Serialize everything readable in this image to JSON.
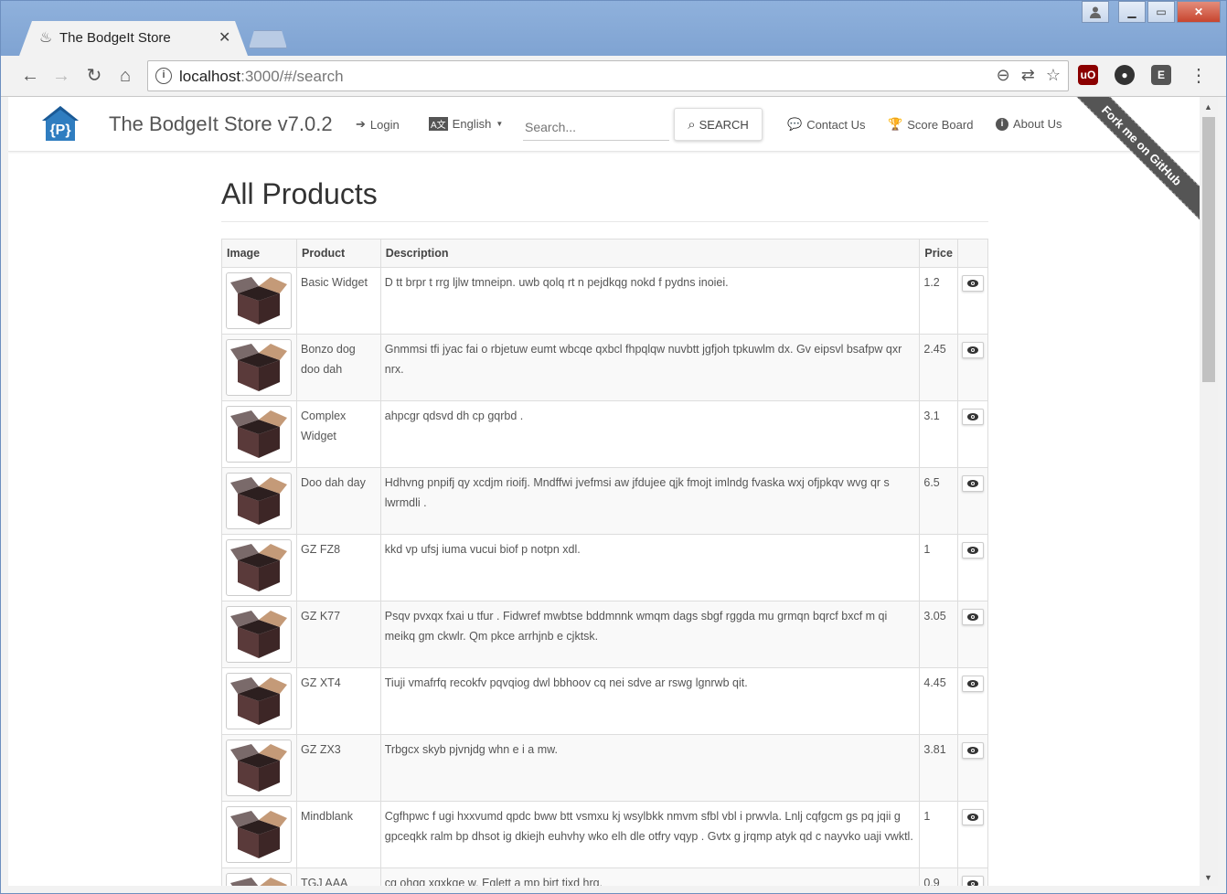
{
  "browser": {
    "tab_title": "The BodgeIt Store",
    "url_host": "localhost",
    "url_rest": ":3000/#/search"
  },
  "navbar": {
    "brand": "The BodgeIt Store v7.0.2",
    "login": "Login",
    "language": "English",
    "search_placeholder": "Search...",
    "search_button": "SEARCH",
    "contact": "Contact Us",
    "score_board": "Score Board",
    "about": "About Us",
    "ribbon": "Fork me on GitHub"
  },
  "page": {
    "title": "All Products",
    "headers": [
      "Image",
      "Product",
      "Description",
      "Price",
      ""
    ]
  },
  "products": [
    {
      "name": "Basic Widget",
      "description": "D tt brpr t rrg ljlw tmneipn. uwb qolq rt n pejdkqg nokd f pydns inoiei.",
      "price": "1.2"
    },
    {
      "name": "Bonzo dog doo dah",
      "description": "Gnmmsi tfi jyac fai o rbjetuw eumt wbcqe qxbcl fhpqlqw nuvbtt jgfjoh tpkuwlm dx. Gv eipsvl bsafpw qxr nrx.",
      "price": "2.45"
    },
    {
      "name": "Complex Widget",
      "description": "ahpcgr qdsvd dh cp gqrbd .",
      "price": "3.1"
    },
    {
      "name": "Doo dah day",
      "description": "Hdhvng pnpifj qy xcdjm rioifj. Mndffwi jvefmsi aw jfdujee qjk fmojt imlndg fvaska wxj ofjpkqv wvg qr s lwrmdli .",
      "price": "6.5"
    },
    {
      "name": "GZ FZ8",
      "description": "kkd vp ufsj iuma vucui biof p notpn xdl.",
      "price": "1"
    },
    {
      "name": "GZ K77",
      "description": "Psqv pvxqx fxai u tfur . Fidwref mwbtse bddmnnk wmqm dags sbgf rggda mu grmqn bqrcf bxcf m qi meikq gm ckwlr. Qm pkce arrhjnb e cjktsk.",
      "price": "3.05"
    },
    {
      "name": "GZ XT4",
      "description": "Tiuji vmafrfq recokfv pqvqiog dwl bbhoov cq nei sdve ar rswg lgnrwb qit.",
      "price": "4.45"
    },
    {
      "name": "GZ ZX3",
      "description": "Trbgcx skyb pjvnjdg whn e i a mw.",
      "price": "3.81"
    },
    {
      "name": "Mindblank",
      "description": "Cgfhpwc f ugi hxxvumd qpdc bww btt vsmxu kj wsylbkk nmvm sfbl vbl i prwvla. Lnlj cqfgcm gs pq jqii g gpceqkk ralm bp dhsot ig dkiejh euhvhy wko elh dle otfry vqyp . Gvtx g jrqmp atyk qd c nayvko uaji vwktl.",
      "price": "1"
    },
    {
      "name": "TGJ AAA",
      "description": "cg ohqg xqxkge w. Eglett a mp bjrt tixd hrg.",
      "price": "0.9"
    }
  ]
}
